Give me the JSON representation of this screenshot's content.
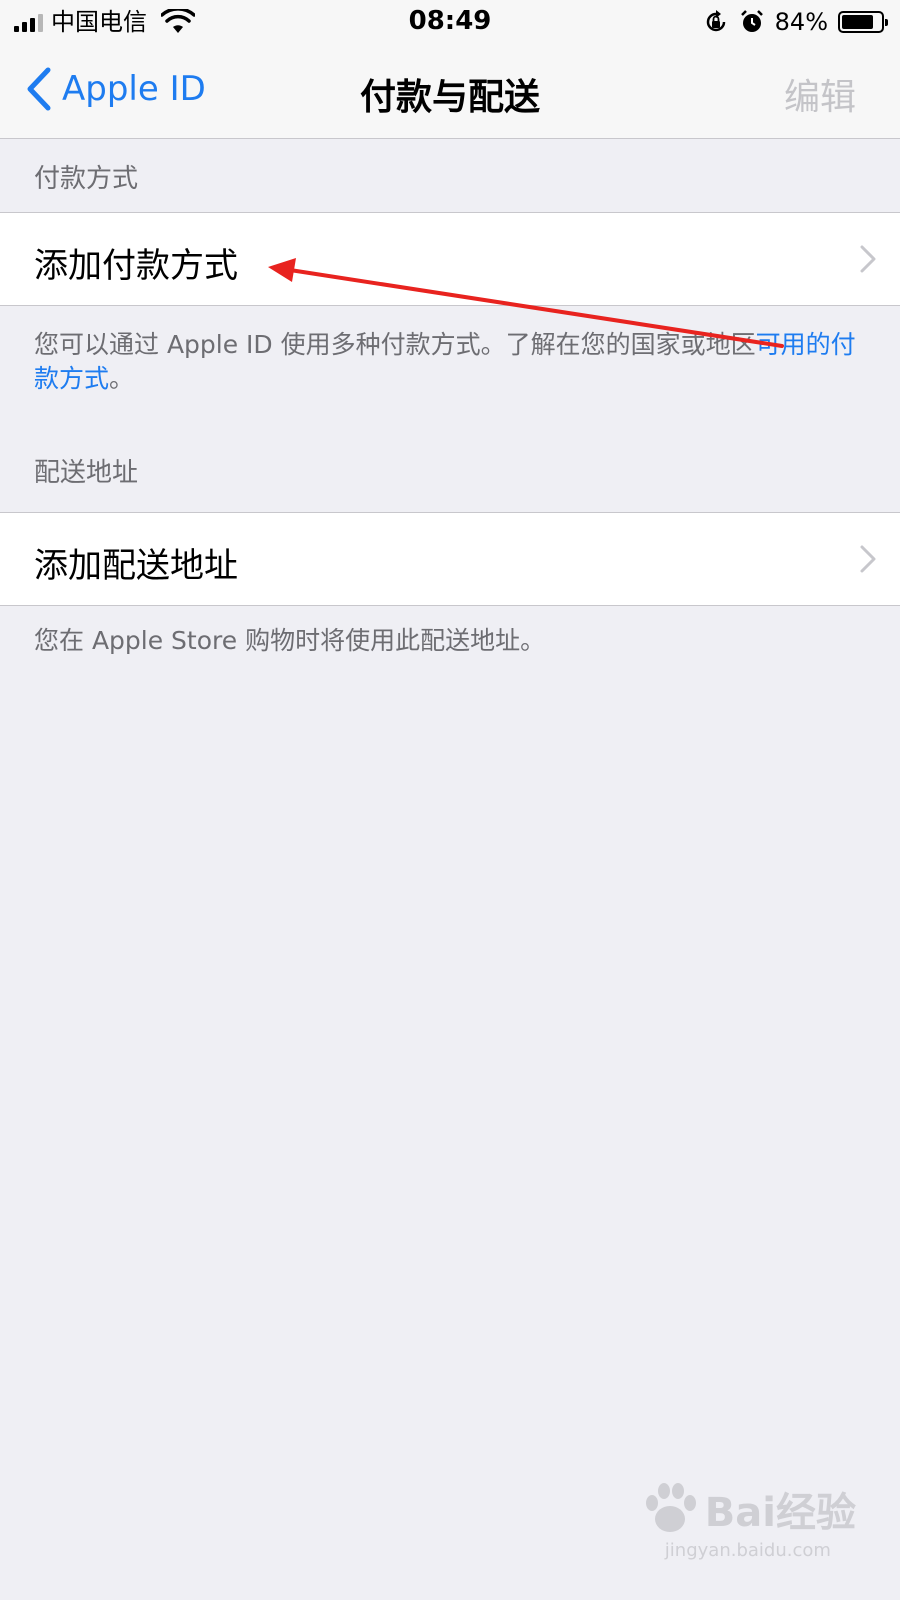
{
  "status_bar": {
    "carrier": "中国电信",
    "time": "08:49",
    "battery": "84%",
    "battery_level": 0.84
  },
  "nav": {
    "back_label": "Apple ID",
    "title": "付款与配送",
    "edit_label": "编辑"
  },
  "payment": {
    "header": "付款方式",
    "add_label": "添加付款方式",
    "footer_text": "您可以通过 Apple ID 使用多种付款方式。了解在您的国家或地区",
    "footer_link": "可用的付款方式",
    "footer_end": "。"
  },
  "shipping": {
    "header": "配送地址",
    "add_label": "添加配送地址",
    "footer_text": "您在 Apple Store 购物时将使用此配送地址。"
  },
  "watermark": {
    "brand": "Bai经验",
    "url": "jingyan.baidu.com"
  },
  "colors": {
    "accent": "#1e7cf0",
    "background": "#efeff4",
    "annotation_arrow": "#e8231f"
  }
}
